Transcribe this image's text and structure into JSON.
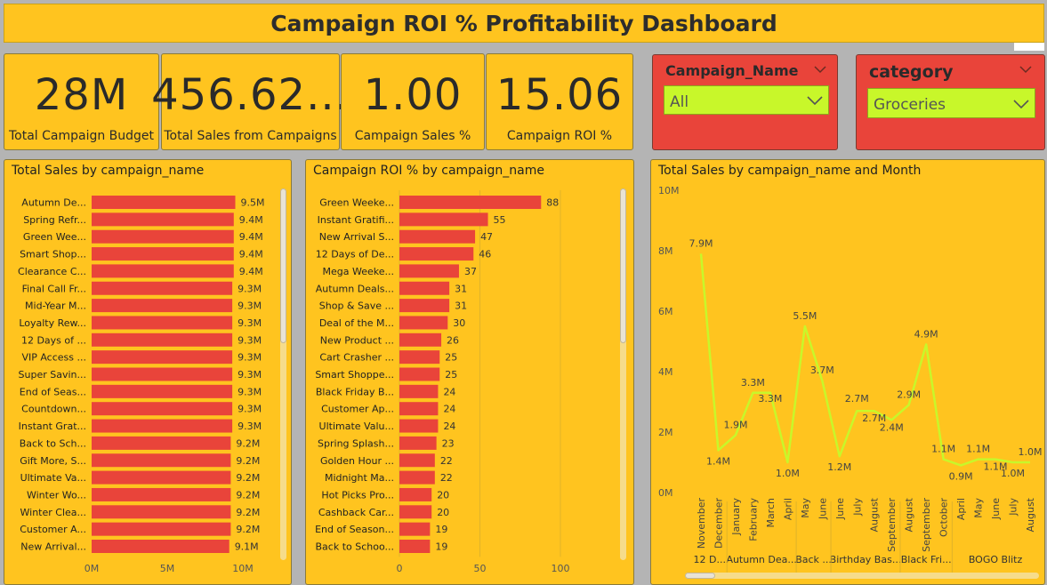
{
  "header": {
    "title": "Campaign ROI % Profitability Dashboard"
  },
  "kpis": [
    {
      "value": "28M",
      "label": "Total Campaign Budget"
    },
    {
      "value": "456.62...",
      "label": "Total Sales from Campaigns"
    },
    {
      "value": "1.00",
      "label": "Campaign Sales %"
    },
    {
      "value": "15.06",
      "label": "Campaign ROI %"
    }
  ],
  "slicers": {
    "campaign": {
      "title": "Campaign_Name",
      "selected": "All"
    },
    "category": {
      "title": "category",
      "selected": "Groceries"
    }
  },
  "colors": {
    "panel": "#ffc41f",
    "bar": "#e9443a",
    "line": "#c8f72a",
    "slicer_bg": "#e9443a",
    "slicer_field": "#c8f72a"
  },
  "icons": {
    "slicer_chevron": "chevron-down-icon"
  },
  "chart_data": [
    {
      "type": "bar",
      "orientation": "horizontal",
      "title": "Total Sales by campaign_name",
      "categories": [
        "Autumn De...",
        "Spring Refr...",
        "Green Wee...",
        "Smart Shop...",
        "Clearance C...",
        "Final Call Fr...",
        "Mid-Year M...",
        "Loyalty Rew...",
        "12 Days of ...",
        "VIP Access ...",
        "Super Savin...",
        "End of Seas...",
        "Countdown...",
        "Instant Grat...",
        "Back to Sch...",
        "Gift More, S...",
        "Ultimate Va...",
        "Winter Wo...",
        "Winter Clea...",
        "Customer A...",
        "New Arrival..."
      ],
      "values": [
        9.5,
        9.4,
        9.4,
        9.4,
        9.4,
        9.3,
        9.3,
        9.3,
        9.3,
        9.3,
        9.3,
        9.3,
        9.3,
        9.3,
        9.2,
        9.2,
        9.2,
        9.2,
        9.2,
        9.2,
        9.1
      ],
      "labels": [
        "9.5M",
        "9.4M",
        "9.4M",
        "9.4M",
        "9.4M",
        "9.3M",
        "9.3M",
        "9.3M",
        "9.3M",
        "9.3M",
        "9.3M",
        "9.3M",
        "9.3M",
        "9.3M",
        "9.2M",
        "9.2M",
        "9.2M",
        "9.2M",
        "9.2M",
        "9.2M",
        "9.1M"
      ],
      "xlim": [
        0,
        10
      ],
      "xticks": [
        "0M",
        "5M",
        "10M"
      ],
      "grid": false
    },
    {
      "type": "bar",
      "orientation": "horizontal",
      "title": "Campaign ROI % by campaign_name",
      "categories": [
        "Green Weeke...",
        "Instant Gratifi...",
        "New Arrival S...",
        "12 Days of De...",
        "Mega Weeke...",
        "Autumn Deals...",
        "Shop & Save ...",
        "Deal of the M...",
        "New Product ...",
        "Cart Crasher ...",
        "Smart Shoppe...",
        "Black Friday B...",
        "Customer Ap...",
        "Ultimate Valu...",
        "Spring Splash...",
        "Golden Hour ...",
        "Midnight Ma...",
        "Hot Picks Pro...",
        "Cashback Car...",
        "End of Season...",
        "Back to Schoo..."
      ],
      "values": [
        88,
        55,
        47,
        46,
        37,
        31,
        31,
        30,
        26,
        25,
        25,
        24,
        24,
        24,
        23,
        22,
        22,
        20,
        20,
        19,
        19
      ],
      "labels": [
        "88",
        "55",
        "47",
        "46",
        "37",
        "31",
        "31",
        "30",
        "26",
        "25",
        "25",
        "24",
        "24",
        "24",
        "23",
        "22",
        "22",
        "20",
        "20",
        "19",
        "19"
      ],
      "xlim": [
        0,
        100
      ],
      "xticks": [
        "0",
        "50",
        "100"
      ],
      "grid": true
    },
    {
      "type": "line",
      "title": "Total Sales by campaign_name and Month",
      "x": [
        "November",
        "December",
        "January",
        "February",
        "March",
        "April",
        "May",
        "June",
        "June",
        "July",
        "August",
        "September",
        "August",
        "September",
        "October",
        "April",
        "May",
        "June",
        "July",
        "August"
      ],
      "values": [
        7.9,
        1.4,
        1.9,
        3.3,
        3.3,
        1.0,
        5.5,
        3.7,
        1.2,
        2.7,
        2.7,
        2.4,
        2.9,
        4.9,
        1.1,
        0.9,
        1.1,
        1.1,
        1.0,
        1.0
      ],
      "labels": [
        "7.9M",
        "1.4M",
        "1.9M",
        "3.3M",
        "3.3M",
        "1.0M",
        "5.5M",
        "3.7M",
        "1.2M",
        "2.7M",
        "2.7M",
        "2.4M",
        "2.9M",
        "4.9M",
        "1.1M",
        "0.9M",
        "1.1M",
        "1.1M",
        "1.0M",
        "1.0M"
      ],
      "groups": [
        {
          "label": "12 D...",
          "from": 0,
          "to": 1
        },
        {
          "label": "Autumn Dea...",
          "from": 2,
          "to": 5
        },
        {
          "label": "Back ...",
          "from": 6,
          "to": 7
        },
        {
          "label": "Birthday Bas...",
          "from": 8,
          "to": 11
        },
        {
          "label": "Black Fri...",
          "from": 12,
          "to": 14
        },
        {
          "label": "BOGO Blitz",
          "from": 15,
          "to": 19
        }
      ],
      "ylim": [
        0,
        10
      ],
      "yticks": [
        "0M",
        "2M",
        "4M",
        "6M",
        "8M",
        "10M"
      ],
      "grid": false
    }
  ]
}
